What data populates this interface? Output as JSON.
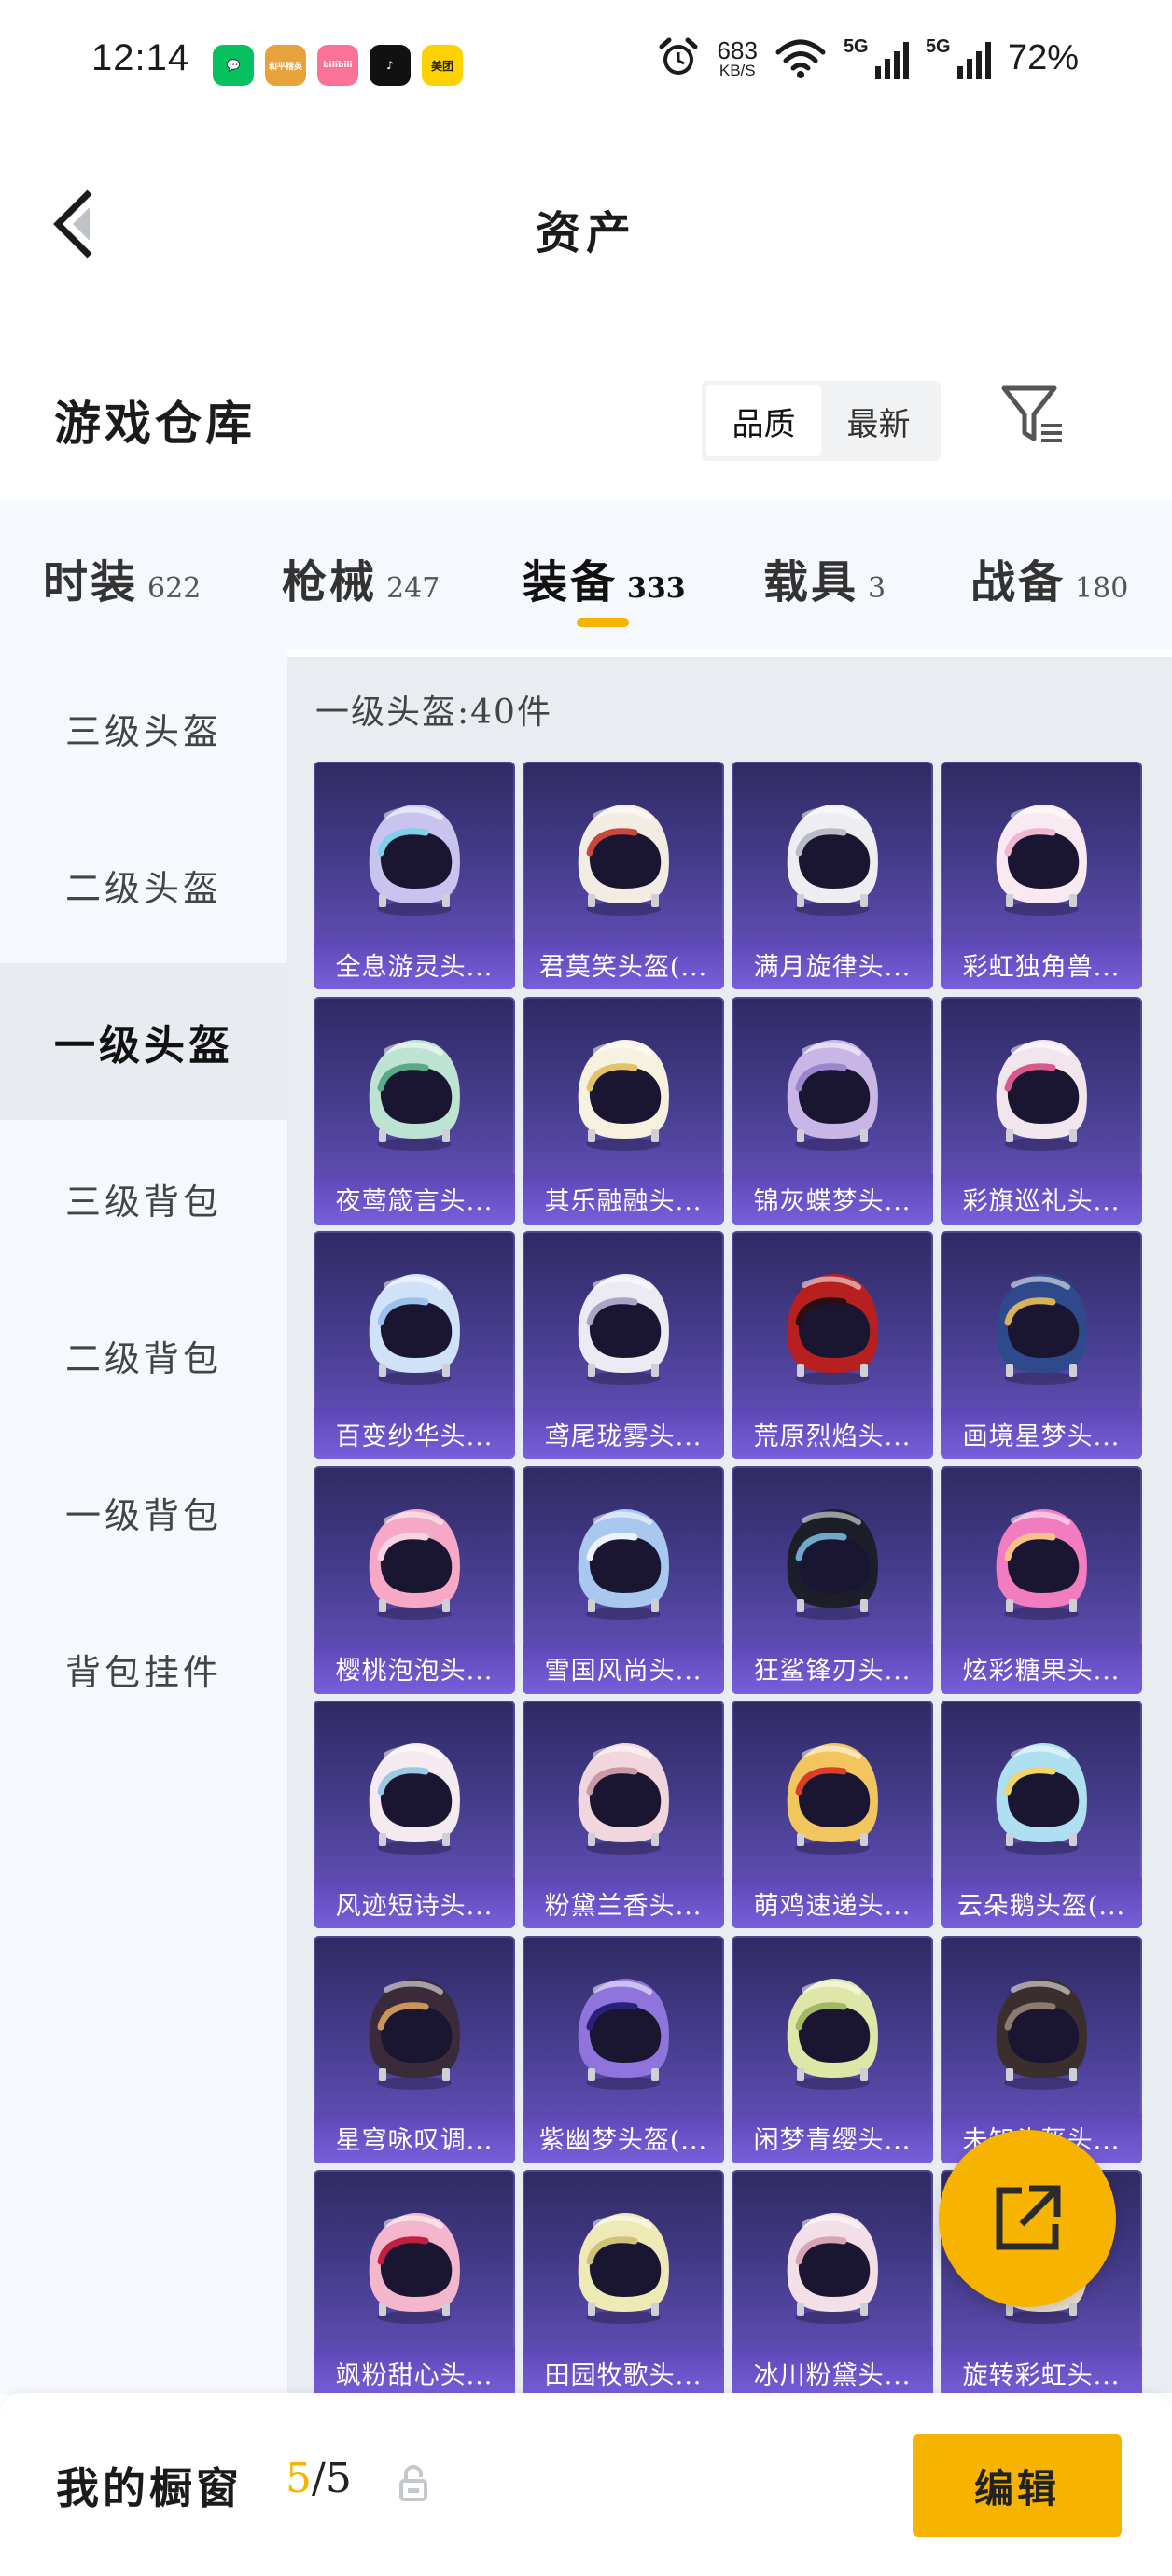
{
  "status_bar": {
    "time": "12:14",
    "apps": [
      {
        "name": "wechat-app-icon",
        "color": "#07c160",
        "glyph": "💬"
      },
      {
        "name": "game-app-icon",
        "color": "#e8a23b",
        "glyph": "和平精英"
      },
      {
        "name": "bilibili-app-icon",
        "color": "#fb7299",
        "glyph": "bilibili"
      },
      {
        "name": "tiktok-app-icon",
        "color": "#111111",
        "glyph": "♪"
      },
      {
        "name": "meituan-app-icon",
        "color": "#ffd100",
        "glyph": "美团"
      }
    ],
    "net_speed_value": "683",
    "net_speed_unit": "KB/S",
    "signal_1_label": "5G",
    "signal_2_label": "5G",
    "battery": "72%"
  },
  "nav": {
    "title": "资产"
  },
  "section": {
    "title": "游戏仓库",
    "sort_options": [
      "品质",
      "最新"
    ],
    "sort_active": 0
  },
  "tabs": [
    {
      "label": "时装",
      "count": "622"
    },
    {
      "label": "枪械",
      "count": "247"
    },
    {
      "label": "装备",
      "count": "333",
      "active": true
    },
    {
      "label": "载具",
      "count": "3"
    },
    {
      "label": "战备",
      "count": "180"
    }
  ],
  "sidebar": {
    "items": [
      "三级头盔",
      "二级头盔",
      "一级头盔",
      "三级背包",
      "二级背包",
      "一级背包",
      "背包挂件"
    ],
    "active_index": 2
  },
  "content": {
    "count_label": "一级头盔:40件",
    "items": [
      {
        "name": "全息游灵头...",
        "shell": "#c9c4ef",
        "trim": "#7fd0e8"
      },
      {
        "name": "君莫笑头盔(...",
        "shell": "#f3ece2",
        "trim": "#c9473c"
      },
      {
        "name": "满月旋律头...",
        "shell": "#eeeef2",
        "trim": "#b9bcc8"
      },
      {
        "name": "彩虹独角兽...",
        "shell": "#f8eaf0",
        "trim": "#f0b6cf"
      },
      {
        "name": "夜莺箴言头...",
        "shell": "#bde3d2",
        "trim": "#5ca98a"
      },
      {
        "name": "其乐融融头...",
        "shell": "#f7f1e0",
        "trim": "#e3c36a"
      },
      {
        "name": "锦灰蝶梦头...",
        "shell": "#c7b6e6",
        "trim": "#9a86cc"
      },
      {
        "name": "彩旗巡礼头...",
        "shell": "#f2e6ee",
        "trim": "#d95a8a"
      },
      {
        "name": "百变纱华头...",
        "shell": "#cfe2f7",
        "trim": "#9cc2ec"
      },
      {
        "name": "鸢尾珑雾头...",
        "shell": "#ecebf4",
        "trim": "#a8a6c6"
      },
      {
        "name": "荒原烈焰头...",
        "shell": "#b8201f",
        "trim": "#2a0f12"
      },
      {
        "name": "画境星梦头...",
        "shell": "#2f4a8c",
        "trim": "#d8b25a"
      },
      {
        "name": "樱桃泡泡头...",
        "shell": "#f5a9c6",
        "trim": "#f8d3e2"
      },
      {
        "name": "雪国风尚头...",
        "shell": "#a9c8ef",
        "trim": "#eef3fb"
      },
      {
        "name": "狂鲨锋刃头...",
        "shell": "#1c1f2a",
        "trim": "#6fa8c8"
      },
      {
        "name": "炫彩糖果头...",
        "shell": "#f27cc0",
        "trim": "#f6c28a"
      },
      {
        "name": "风迹短诗头...",
        "shell": "#f4eaf0",
        "trim": "#9cc9e6"
      },
      {
        "name": "粉黛兰香头...",
        "shell": "#f1d7dd",
        "trim": "#c99aa6"
      },
      {
        "name": "萌鸡速递头...",
        "shell": "#f3c55f",
        "trim": "#d8402c"
      },
      {
        "name": "云朵鹅头盔(...",
        "shell": "#aee0f2",
        "trim": "#f1d46a"
      },
      {
        "name": "星穹咏叹调...",
        "shell": "#3b2a3a",
        "trim": "#c9965a"
      },
      {
        "name": "紫幽梦头盔(...",
        "shell": "#8f74dd",
        "trim": "#2a227a"
      },
      {
        "name": "闲梦青缨头...",
        "shell": "#dfe7a8",
        "trim": "#a3b864"
      },
      {
        "name": "未知头盔头...",
        "shell": "#3a2f2c",
        "trim": "#8a7a70"
      },
      {
        "name": "飒粉甜心头...",
        "shell": "#f4b6cc",
        "trim": "#c21e3f"
      },
      {
        "name": "田园牧歌头...",
        "shell": "#eeeab6",
        "trim": "#cfc37a"
      },
      {
        "name": "冰川粉黛头...",
        "shell": "#f3dfe7",
        "trim": "#d9a3b6"
      },
      {
        "name": "旋转彩虹头...",
        "shell": "#f3e4d2",
        "trim": "#e4b48e"
      }
    ]
  },
  "bottom_bar": {
    "label": "我的橱窗",
    "count_current": "5",
    "count_separator": "/",
    "count_total": "5",
    "edit_label": "编辑"
  },
  "colors": {
    "accent": "#f6b400",
    "card_top": "#2f2a63",
    "card_bottom": "#6d55c8"
  }
}
